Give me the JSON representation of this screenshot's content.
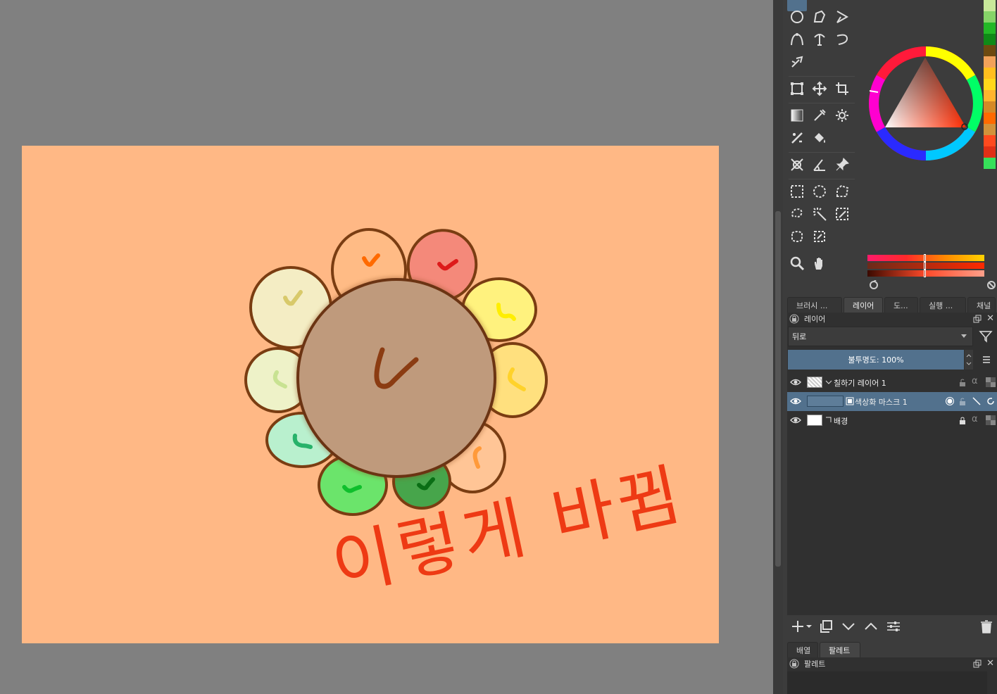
{
  "canvas": {
    "background_color": "#ffb885",
    "handwriting_text": "이렇게 바뀜",
    "handwriting_color": "#ee3a14"
  },
  "tabs_top": [
    {
      "label": "브러시 ...",
      "active": false
    },
    {
      "label": "레이어",
      "active": true
    },
    {
      "label": "도...",
      "active": false
    },
    {
      "label": "실행 ...",
      "active": false
    },
    {
      "label": "채널",
      "active": false
    }
  ],
  "layers_docker": {
    "title": "레이어",
    "blend_mode": "뒤로",
    "opacity_label": "불투명도:  100%",
    "layers": [
      {
        "name": "칠하기 레이어 1",
        "selected": false
      },
      {
        "name": "색상화 마스크 1",
        "selected": true
      },
      {
        "name": "배경",
        "selected": false
      }
    ]
  },
  "tabs_bottom": [
    {
      "label": "배열",
      "active": false
    },
    {
      "label": "팔레트",
      "active": true
    }
  ],
  "palette_docker": {
    "title": "팔레트"
  },
  "swatch_colors": [
    "#c8e89a",
    "#86d468",
    "#23b826",
    "#0f8a17",
    "#6e4a10",
    "#f2a25a",
    "#ffbf1e",
    "#ffd81a",
    "#ffb52e",
    "#d58a27",
    "#ff6a00",
    "#d2923a",
    "#ff4a1e",
    "#e03016",
    "#36e05a"
  ],
  "accent_selected": "#52718d"
}
